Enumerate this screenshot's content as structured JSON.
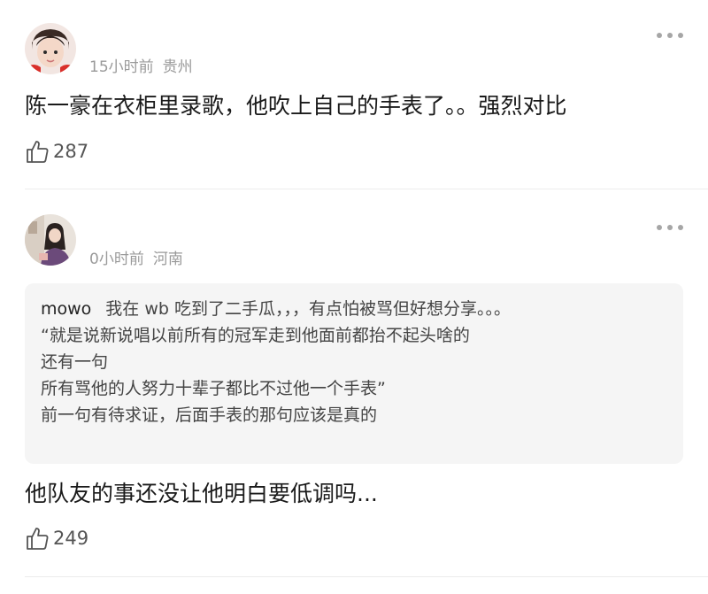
{
  "comments": [
    {
      "time": "15小时前",
      "location": "贵州",
      "text": "陈一豪在衣柜里录歌，他吹上自己的手表了。。强烈对比",
      "likes": "287"
    },
    {
      "time": "0小时前",
      "location": "河南",
      "quote": {
        "author": "mowo",
        "first_line": "我在 wb 吃到了二手瓜，，，有点怕被骂但好想分享。。。",
        "lines": [
          "“就是说新说唱以前所有的冠军走到他面前都抬不起头啥的",
          "还有一句",
          "所有骂他的人努力十辈子都比不过他一个手表”",
          "前一句有待求证，后面手表的那句应该是真的"
        ]
      },
      "text": "他队友的事还没让他明白要低调吗...",
      "likes": "249"
    }
  ],
  "icons": {
    "more": "more-dots-icon",
    "like": "thumbs-up-icon"
  },
  "colors": {
    "meta": "#9a9a9a",
    "quote_bg": "#f5f5f5",
    "divider": "#ececec"
  }
}
